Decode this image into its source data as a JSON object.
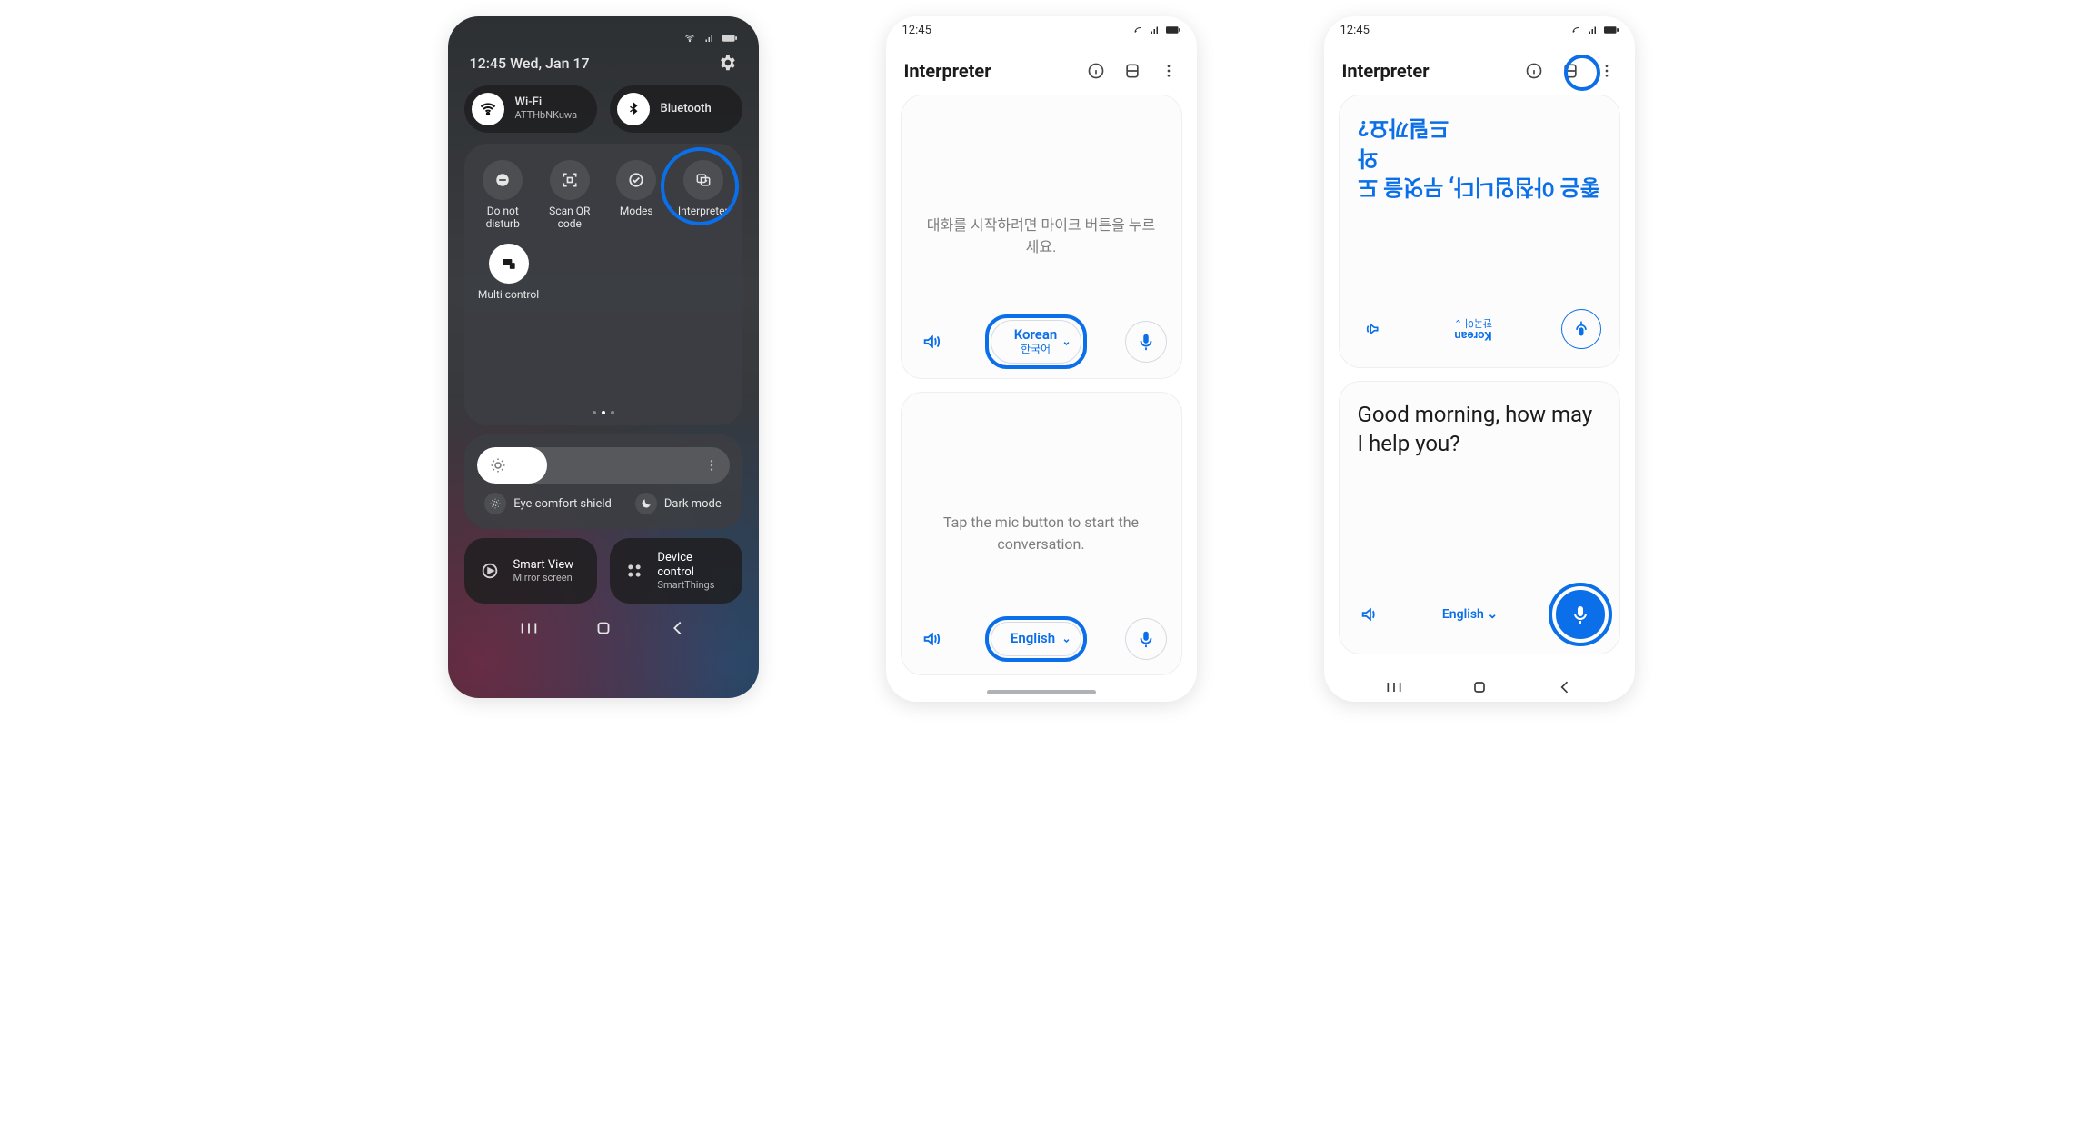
{
  "colors": {
    "highlight": "#0a6fe8"
  },
  "phone1": {
    "status": {
      "wifi_icon": "wifi",
      "signal_icon": "signal",
      "battery_icon": "battery"
    },
    "datetime": "12:45 Wed, Jan 17",
    "settings_icon": "gear",
    "pills": {
      "wifi": {
        "title": "Wi-Fi",
        "subtitle": "ATTHbNKuwa"
      },
      "bluetooth": {
        "title": "Bluetooth"
      }
    },
    "tiles": {
      "dnd": "Do not disturb",
      "scanqr": "Scan QR code",
      "modes": "Modes",
      "interpreter": "Interpreter",
      "multictrl": "Multi control"
    },
    "brightness": {
      "percent": 28
    },
    "toggles": {
      "eyecomfort": "Eye comfort shield",
      "darkmode": "Dark mode"
    },
    "cards": {
      "smartview": {
        "title": "Smart View",
        "subtitle": "Mirror screen"
      },
      "devicecontrol": {
        "title": "Device control",
        "subtitle": "SmartThings"
      }
    }
  },
  "phone2": {
    "time": "12:45",
    "title": "Interpreter",
    "panes": {
      "top": {
        "placeholder": "대화를 시작하려면 마이크 버튼을 누르세요."
      },
      "bottom": {
        "placeholder": "Tap the mic button to start the conversation."
      }
    },
    "langs": {
      "top": {
        "name": "Korean",
        "native": "한국어"
      },
      "bottom": {
        "name": "English"
      }
    }
  },
  "phone3": {
    "time": "12:45",
    "title": "Interpreter",
    "top": {
      "lang": {
        "name": "Korean",
        "native": "한국어"
      },
      "output": "좋은 아침입니다, 무엇을 도와\n드릴까요?"
    },
    "bottom": {
      "text": "Good morning, how may I help you?",
      "lang": "English"
    }
  }
}
